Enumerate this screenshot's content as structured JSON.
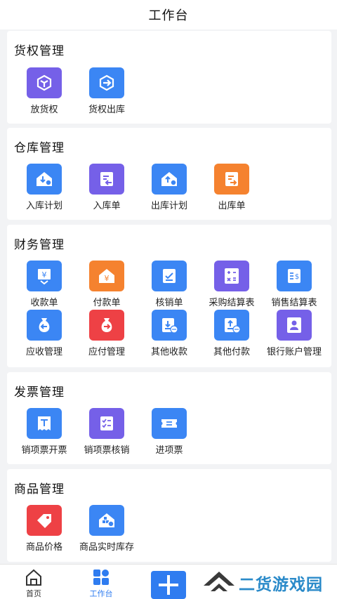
{
  "header": {
    "title": "工作台"
  },
  "sections": [
    {
      "title": "货权管理",
      "items": [
        {
          "label": "放货权",
          "color": "purple",
          "icon": "release-goods-icon"
        },
        {
          "label": "货权出库",
          "color": "blue",
          "icon": "goods-outbound-icon"
        }
      ]
    },
    {
      "title": "仓库管理",
      "items": [
        {
          "label": "入库计划",
          "color": "blue",
          "icon": "inbound-plan-icon"
        },
        {
          "label": "入库单",
          "color": "purple",
          "icon": "inbound-order-icon"
        },
        {
          "label": "出库计划",
          "color": "blue",
          "icon": "outbound-plan-icon"
        },
        {
          "label": "出库单",
          "color": "orange",
          "icon": "outbound-order-icon"
        }
      ]
    },
    {
      "title": "财务管理",
      "items": [
        {
          "label": "收款单",
          "color": "blue",
          "icon": "receipt-icon"
        },
        {
          "label": "付款单",
          "color": "orange",
          "icon": "payment-icon"
        },
        {
          "label": "核销单",
          "color": "blue",
          "icon": "writeoff-icon"
        },
        {
          "label": "采购结算表",
          "color": "purple",
          "icon": "calculator-icon"
        },
        {
          "label": "销售结算表",
          "color": "blue",
          "icon": "sales-statement-icon"
        },
        {
          "label": "应收管理",
          "color": "blue",
          "icon": "receivable-icon"
        },
        {
          "label": "应付管理",
          "color": "red",
          "icon": "payable-icon"
        },
        {
          "label": "其他收款",
          "color": "blue",
          "icon": "other-receipt-icon"
        },
        {
          "label": "其他付款",
          "color": "blue",
          "icon": "other-payment-icon"
        },
        {
          "label": "银行账户管理",
          "color": "purple",
          "icon": "bank-account-icon"
        }
      ]
    },
    {
      "title": "发票管理",
      "items": [
        {
          "label": "销项票开票",
          "color": "blue",
          "icon": "invoice-issue-icon"
        },
        {
          "label": "销项票核销",
          "color": "purple",
          "icon": "invoice-writeoff-icon"
        },
        {
          "label": "进项票",
          "color": "blue",
          "icon": "input-invoice-icon"
        }
      ]
    },
    {
      "title": "商品管理",
      "items": [
        {
          "label": "商品价格",
          "color": "red",
          "icon": "price-tag-icon"
        },
        {
          "label": "商品实时库存",
          "color": "blue",
          "icon": "realtime-stock-icon"
        }
      ]
    }
  ],
  "tabbar": {
    "home_label": "首页",
    "workbench_label": "工作台",
    "active_color": "#2f7cf0"
  },
  "watermark": {
    "text": "二货游戏园"
  }
}
